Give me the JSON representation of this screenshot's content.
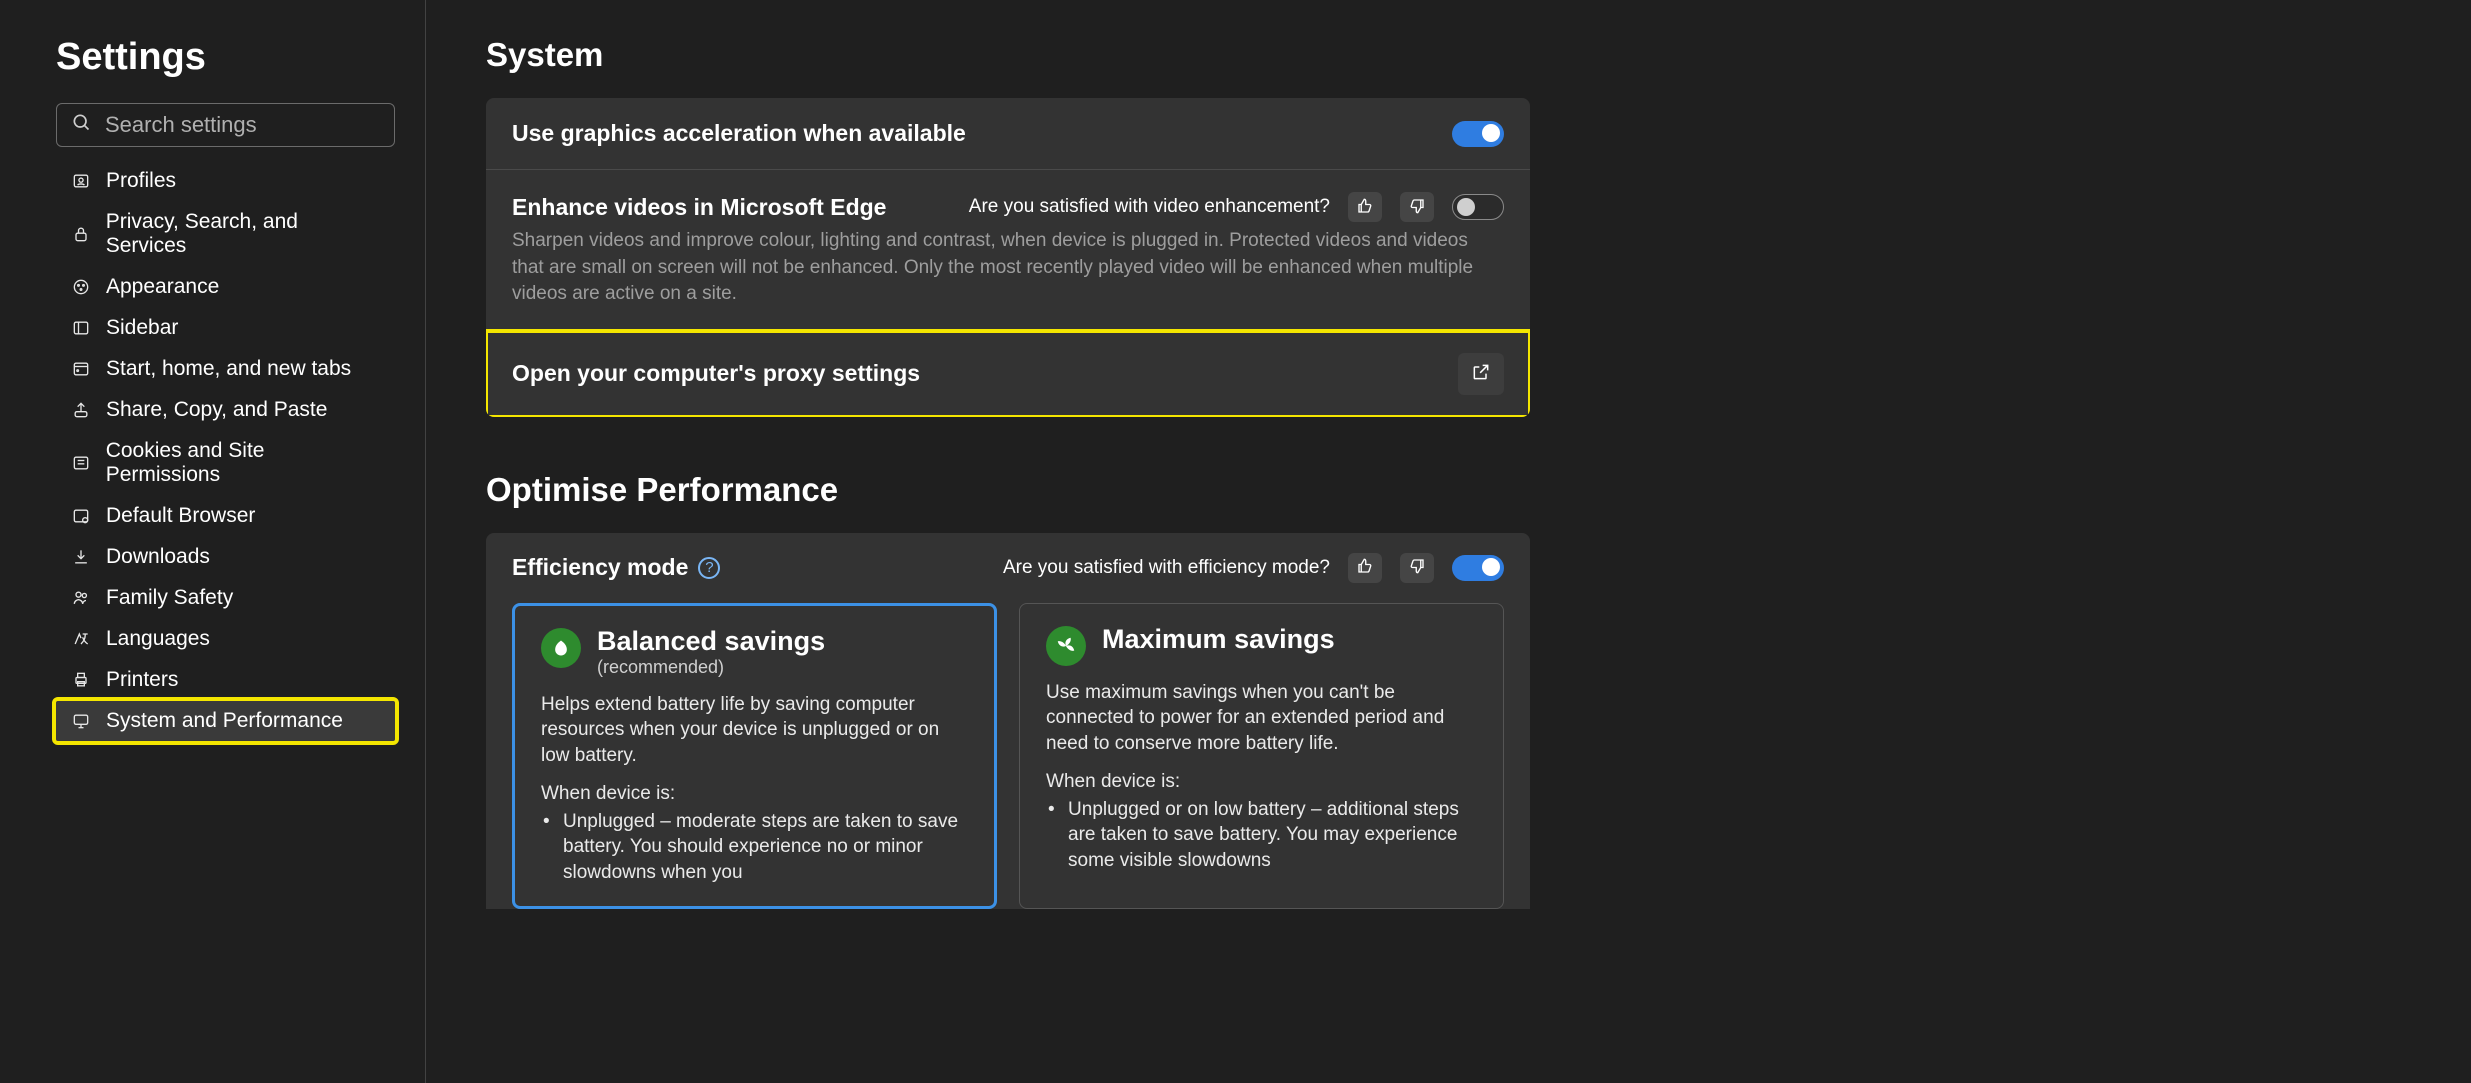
{
  "sidebar": {
    "title": "Settings",
    "search_placeholder": "Search settings",
    "items": [
      {
        "label": "Profiles",
        "icon": "profile"
      },
      {
        "label": "Privacy, Search, and Services",
        "icon": "lock"
      },
      {
        "label": "Appearance",
        "icon": "appearance"
      },
      {
        "label": "Sidebar",
        "icon": "sidebar"
      },
      {
        "label": "Start, home, and new tabs",
        "icon": "start"
      },
      {
        "label": "Share, Copy, and Paste",
        "icon": "share"
      },
      {
        "label": "Cookies and Site Permissions",
        "icon": "cookies"
      },
      {
        "label": "Default Browser",
        "icon": "default-browser"
      },
      {
        "label": "Downloads",
        "icon": "download"
      },
      {
        "label": "Family Safety",
        "icon": "family"
      },
      {
        "label": "Languages",
        "icon": "language"
      },
      {
        "label": "Printers",
        "icon": "printer"
      },
      {
        "label": "System and Performance",
        "icon": "system"
      }
    ],
    "active_index": 12
  },
  "main": {
    "system": {
      "heading": "System",
      "gpu": {
        "title": "Use graphics acceleration when available",
        "toggle_on": true
      },
      "enhance": {
        "title": "Enhance videos in Microsoft Edge",
        "desc": "Sharpen videos and improve colour, lighting and contrast, when device is plugged in. Protected videos and videos that are small on screen will not be enhanced. Only the most recently played video will be enhanced when multiple videos are active on a site.",
        "feedback_q": "Are you satisfied with video enhancement?",
        "toggle_on": false
      },
      "proxy": {
        "title": "Open your computer's proxy settings"
      }
    },
    "optimise": {
      "heading": "Optimise Performance",
      "efficiency": {
        "title": "Efficiency mode",
        "feedback_q": "Are you satisfied with efficiency mode?",
        "toggle_on": true
      },
      "cards": {
        "balanced": {
          "title": "Balanced savings",
          "sub": "(recommended)",
          "desc": "Helps extend battery life by saving computer resources when your device is unplugged or on low battery.",
          "when": "When device is:",
          "bullet": "Unplugged – moderate steps are taken to save battery. You should experience no or minor slowdowns when you"
        },
        "maximum": {
          "title": "Maximum savings",
          "desc": "Use maximum savings when you can't be connected to power for an extended period and need to conserve more battery life.",
          "when": "When device is:",
          "bullet": "Unplugged or on low battery – additional steps are taken to save battery. You may experience some visible slowdowns"
        }
      }
    }
  }
}
